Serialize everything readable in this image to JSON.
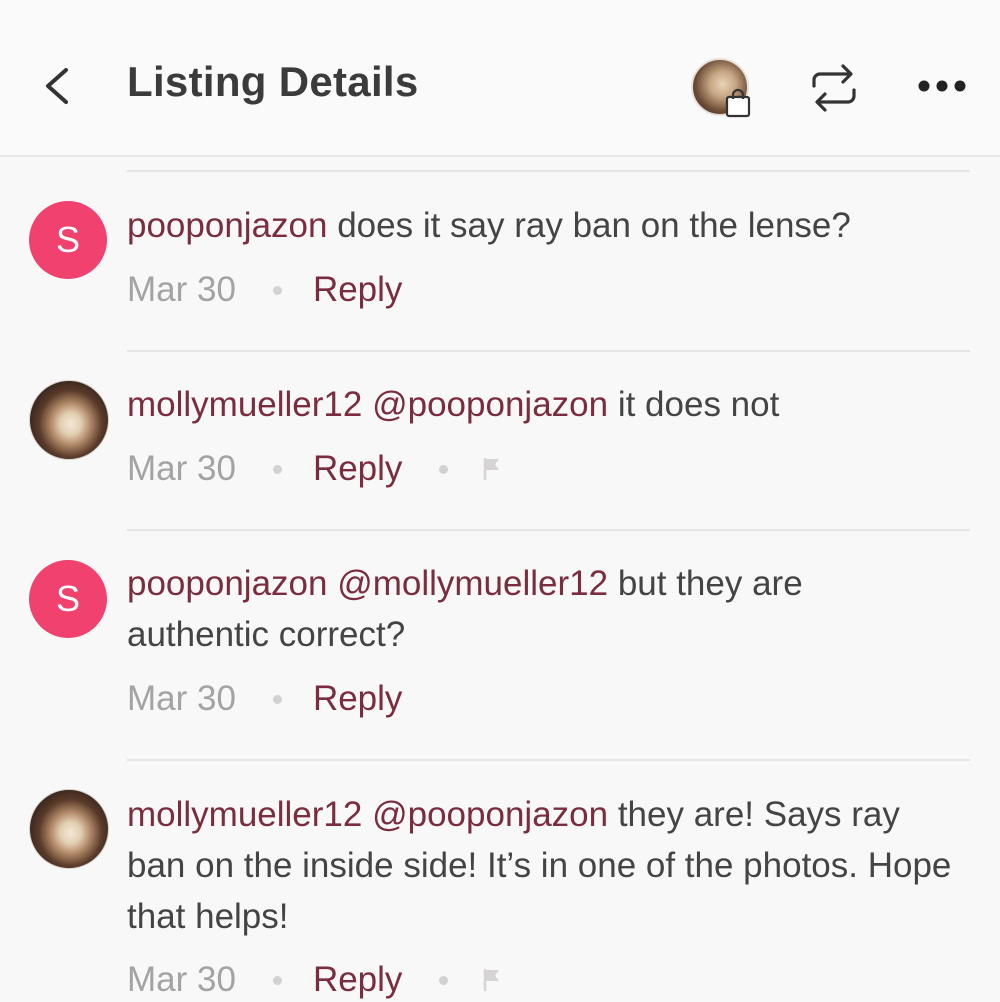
{
  "header": {
    "title": "Listing Details",
    "back_icon": "chevron-left-icon",
    "closet_icon": "closet-avatar-icon",
    "share_icon": "repeat-share-icon",
    "more_icon": "more-horizontal-icon"
  },
  "colors": {
    "accent": "#7a2d3e",
    "avatar_pink": "#f0416f",
    "muted": "#a3a3a3"
  },
  "comments": [
    {
      "avatar_letter": "S",
      "username": "pooponjazon",
      "mention": "",
      "text": " does it say ray ban on the lense?",
      "date": "Mar 30",
      "reply": "Reply"
    },
    {
      "avatar_letter": "",
      "username": "mollymueller12",
      "mention": " @pooponjazon",
      "text": " it does not",
      "date": "Mar 30",
      "reply": "Reply"
    },
    {
      "avatar_letter": "S",
      "username": "pooponjazon",
      "mention": " @mollymueller12",
      "text": " but they are authentic correct?",
      "date": "Mar 30",
      "reply": "Reply"
    },
    {
      "avatar_letter": "",
      "username": "mollymueller12",
      "mention": " @pooponjazon",
      "text": " they are! Says ray ban on the inside side! It’s in one of the photos. Hope that helps!",
      "date": "Mar 30",
      "reply": "Reply"
    }
  ]
}
